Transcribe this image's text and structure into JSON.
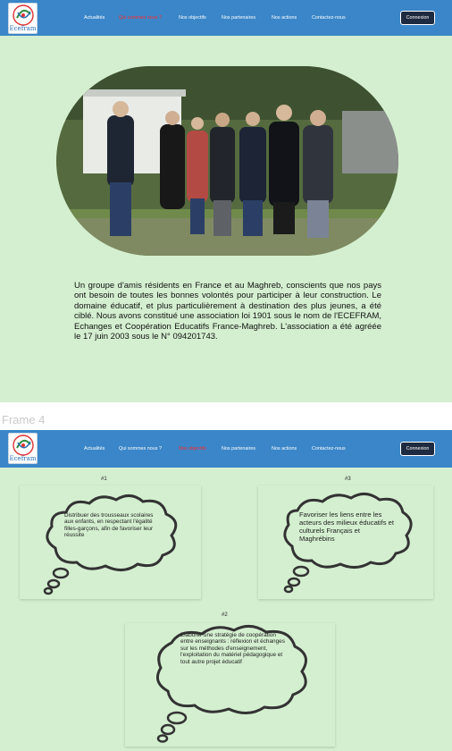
{
  "nav": {
    "logo_text": "Ecefram",
    "items": [
      "Actualités",
      "Qui sommes nous ?",
      "Nos objectifs",
      "Nos partenaires",
      "Nos actions",
      "Contactez-nous"
    ],
    "login_label": "Connexion"
  },
  "about": {
    "active_item": "Qui sommes nous ?",
    "paragraph": "Un groupe d'amis résidents en France et au Maghreb, conscients que nos pays ont besoin de toutes les bonnes volontés pour participer à leur construction. Le domaine éducatif, et plus particulièrement à destination des plus jeunes, a été ciblé. Nous avons constitué une association loi 1901 sous le nom de l'ECEFRAM, Echanges et Coopération Educatifs France-Maghreb. L'association a été agréée le 17 juin 2003 sous le N° 094201743."
  },
  "frame_label": "Frame 4",
  "objectives": {
    "active_item": "Nos objectifs",
    "items": [
      {
        "number": "#1",
        "text": "Distribuer des trousseaux scolaires aux enfants, en respectant l'égalité filles-garçons, afin de favoriser leur réussite"
      },
      {
        "number": "#3",
        "text": "Favoriser les liens entre les acteurs des milieux éducatifs et culturels Français et Maghrébins"
      },
      {
        "number": "#2",
        "text": "Elaborer une stratégie de coopération entre enseignants : réflexion et échanges sur les méthodes d'enseignement, l'exploitation du matériel pédagogique et tout autre projet éducatif"
      }
    ]
  },
  "colors": {
    "navbar": "#3a86c8",
    "background": "#d4efd0",
    "active_link": "#ff2a2a",
    "button": "#1e2a3f"
  }
}
